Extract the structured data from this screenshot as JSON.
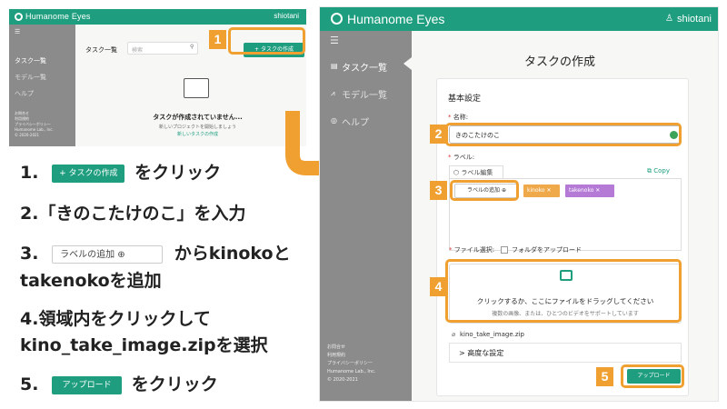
{
  "mini": {
    "brand": "Humanome Eyes",
    "user": "shiotani",
    "nav": [
      "タスク一覧",
      "モデル一覧",
      "ヘルプ"
    ],
    "footer": [
      "お問合せ",
      "利用規約",
      "プライバシーポリシー",
      "Humanome Lab., Inc.",
      "© 2020-2021"
    ],
    "list_label": "タスク一覧",
    "search_placeholder": "検索",
    "create_button": "+ タスクの作成",
    "empty_title": "タスクが作成されていません...",
    "empty_sub": "新しいプロジェクトを開始しましょう",
    "empty_link": "新しいタスクの作成"
  },
  "badges": [
    "1",
    "2",
    "3",
    "4",
    "5"
  ],
  "steps": {
    "s1_num": "1.",
    "s1_pill": "+ タスクの作成",
    "s1_text": "をクリック",
    "s2": "2.「きのこたけのこ」を入力",
    "s3_num": "3.",
    "s3_pill": "ラベルの追加 ⊕",
    "s3_text": "からkinokoと",
    "s3_text2": "takenokoを追加",
    "s4_line1": "4.領域内をクリックして",
    "s4_line2": "kino_take_image.zipを選択",
    "s5_num": "5.",
    "s5_pill": "アップロード",
    "s5_text": "をクリック"
  },
  "big": {
    "brand": "Humanome Eyes",
    "user": "shiotani",
    "nav": [
      "タスク一覧",
      "モデル一覧",
      "ヘルプ"
    ],
    "footer": [
      "お問合せ",
      "利用規約",
      "プライバシーポリシー",
      "Humanome Lab., Inc.",
      "© 2020-2021"
    ],
    "form_title": "タスクの作成",
    "section": "基本設定",
    "name_label": "名称:",
    "name_value": "きのこたけのこ",
    "label_label": "ラベル:",
    "label_tab": "ラベル編集",
    "copy": "Copy",
    "add_label": "ラベルの追加 ⊕",
    "tags": [
      "kinoko ✕",
      "takenoko ✕"
    ],
    "file_label": "ファイル選択:",
    "folder_label": "フォルダをアップロード",
    "drop_text": "クリックするか、ここにファイルをドラッグしてください",
    "drop_sub": "複数の画像、または、ひとつのビデオをサポートしています",
    "filename": "kino_take_image.zip",
    "advanced": "> 高度な設定",
    "upload": "アップロード"
  },
  "colors": {
    "brand_green": "#1e9e7f",
    "accent_orange": "#f0a031",
    "sidebar_gray": "#8b8b8b"
  }
}
